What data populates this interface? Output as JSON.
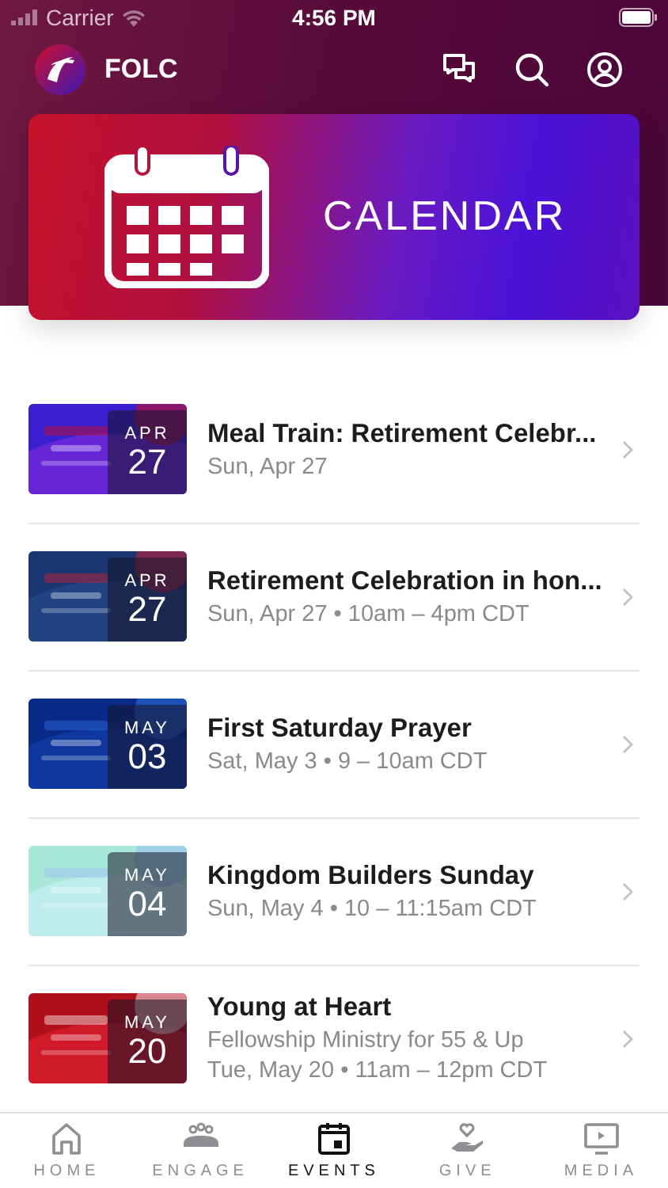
{
  "status_bar": {
    "carrier": "Carrier",
    "time": "4:56 PM"
  },
  "header": {
    "title": "FOLC"
  },
  "banner": {
    "label": "CALENDAR"
  },
  "events": [
    {
      "title": "Meal Train: Retirement Celebr...",
      "lines": [
        "Sun, Apr 27"
      ],
      "month": "APR",
      "day": "27"
    },
    {
      "title": "Retirement Celebration in hon...",
      "lines": [
        "Sun, Apr 27 • 10am – 4pm CDT"
      ],
      "month": "APR",
      "day": "27"
    },
    {
      "title": "First Saturday Prayer",
      "lines": [
        "Sat, May 3 • 9 – 10am CDT"
      ],
      "month": "MAY",
      "day": "03"
    },
    {
      "title": "Kingdom Builders Sunday",
      "lines": [
        "Sun, May 4 • 10 – 11:15am CDT"
      ],
      "month": "MAY",
      "day": "04"
    },
    {
      "title": "Young at Heart",
      "lines": [
        "Fellowship Ministry for 55 & Up",
        "Tue, May 20 • 11am – 12pm CDT"
      ],
      "month": "MAY",
      "day": "20"
    }
  ],
  "tabs": [
    {
      "label": "HOME",
      "kind": "home",
      "selected": false
    },
    {
      "label": "ENGAGE",
      "kind": "engage",
      "selected": false
    },
    {
      "label": "EVENTS",
      "kind": "events",
      "selected": true
    },
    {
      "label": "GIVE",
      "kind": "give",
      "selected": false
    },
    {
      "label": "MEDIA",
      "kind": "media",
      "selected": false
    }
  ]
}
